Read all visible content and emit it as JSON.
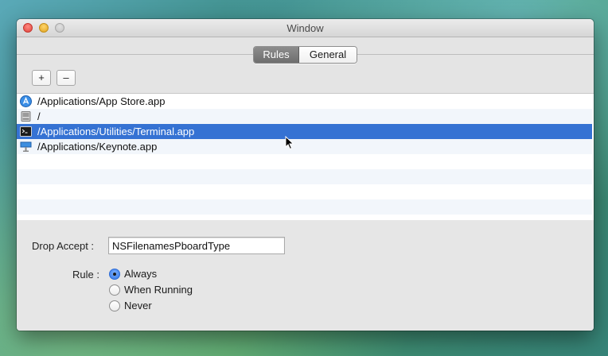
{
  "window": {
    "title": "Window"
  },
  "tabs": [
    {
      "label": "Rules",
      "selected": true
    },
    {
      "label": "General",
      "selected": false
    }
  ],
  "toolbar": {
    "add_label": "+",
    "remove_label": "–"
  },
  "rules_table": {
    "rows": [
      {
        "label": "/Applications/App Store.app",
        "icon": "app-store-icon",
        "selected": false
      },
      {
        "label": "/",
        "icon": "hard-drive-icon",
        "selected": false
      },
      {
        "label": "/Applications/Utilities/Terminal.app",
        "icon": "terminal-icon",
        "selected": true
      },
      {
        "label": "/Applications/Keynote.app",
        "icon": "keynote-icon",
        "selected": false
      }
    ]
  },
  "form": {
    "drop_accept_label": "Drop Accept :",
    "drop_accept_value": "NSFilenamesPboardType",
    "rule_label": "Rule :",
    "rule_options": [
      {
        "label": "Always",
        "checked": true
      },
      {
        "label": "When Running",
        "checked": false
      },
      {
        "label": "Never",
        "checked": false
      }
    ]
  },
  "colors": {
    "selection": "#3572d3",
    "accent": "#2f73e3"
  }
}
